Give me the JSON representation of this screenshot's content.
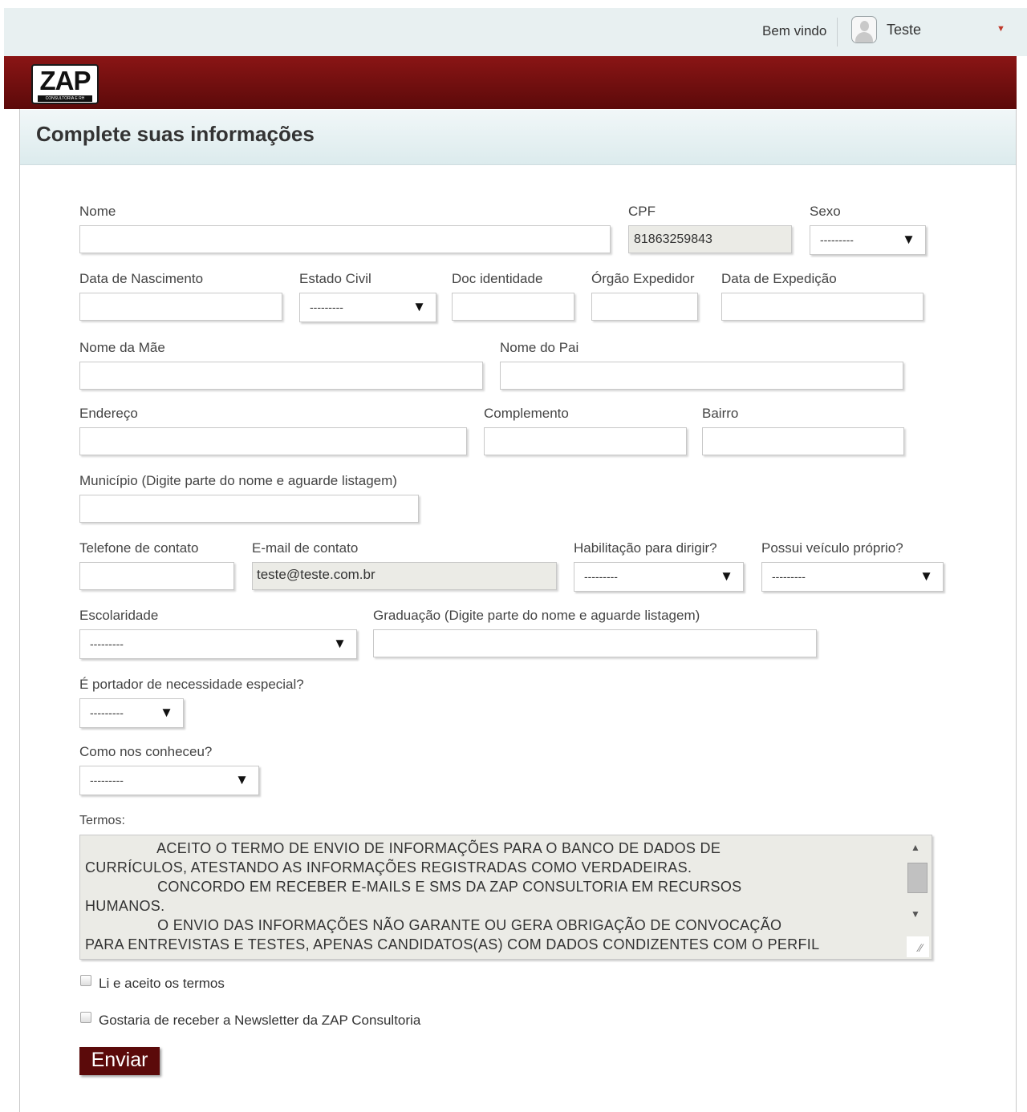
{
  "header": {
    "welcome": "Bem vindo",
    "username": "Teste",
    "user_menu_caret": "▼"
  },
  "brand": {
    "logo_text": "ZAP",
    "logo_sub": "CONSULTORIA E RH"
  },
  "page": {
    "title": "Complete suas informações"
  },
  "form": {
    "nome": {
      "label": "Nome",
      "value": ""
    },
    "cpf": {
      "label": "CPF",
      "value": "81863259843"
    },
    "sexo": {
      "label": "Sexo",
      "value": "---------"
    },
    "data_nascimento": {
      "label": "Data de Nascimento",
      "value": ""
    },
    "estado_civil": {
      "label": "Estado Civil",
      "value": "---------"
    },
    "doc_identidade": {
      "label": "Doc identidade",
      "value": ""
    },
    "orgao_expedidor": {
      "label": "Órgão Expedidor",
      "value": ""
    },
    "data_expedicao": {
      "label": "Data de Expedição",
      "value": ""
    },
    "nome_mae": {
      "label": "Nome da Mãe",
      "value": ""
    },
    "nome_pai": {
      "label": "Nome do Pai",
      "value": ""
    },
    "endereco": {
      "label": "Endereço",
      "value": ""
    },
    "complemento": {
      "label": "Complemento",
      "value": ""
    },
    "bairro": {
      "label": "Bairro",
      "value": ""
    },
    "municipio": {
      "label": "Município (Digite parte do nome e aguarde listagem)",
      "value": ""
    },
    "telefone": {
      "label": "Telefone de contato",
      "value": ""
    },
    "email": {
      "label": "E-mail de contato",
      "value": "teste@teste.com.br"
    },
    "habilitacao": {
      "label": "Habilitação para dirigir?",
      "value": "---------"
    },
    "veiculo": {
      "label": "Possui veículo próprio?",
      "value": "---------"
    },
    "escolaridade": {
      "label": "Escolaridade",
      "value": "---------"
    },
    "graduacao": {
      "label": "Graduação (Digite parte do nome e aguarde listagem)",
      "value": ""
    },
    "necessidade": {
      "label": "É portador de necessidade especial?",
      "value": "---------"
    },
    "como_conheceu": {
      "label": "Como nos conheceu?",
      "value": "---------"
    },
    "termos": {
      "label": "Termos:",
      "text": "                 ACEITO O TERMO DE ENVIO DE INFORMAÇÕES PARA O BANCO DE DADOS DE\nCURRÍCULOS, ATESTANDO AS INFORMAÇÕES REGISTRADAS COMO VERDADEIRAS.\n                 CONCORDO EM RECEBER E-MAILS E SMS DA ZAP CONSULTORIA EM RECURSOS\nHUMANOS.\n                 O ENVIO DAS INFORMAÇÕES NÃO GARANTE OU GERA OBRIGAÇÃO DE CONVOCAÇÃO\nPARA ENTREVISTAS E TESTES, APENAS CANDIDATOS(AS) COM DADOS CONDIZENTES COM O PERFIL"
    },
    "aceito_termos": {
      "label": "Li e aceito os termos",
      "checked": false
    },
    "newsletter": {
      "label": "Gostaria de receber a Newsletter da ZAP Consultoria",
      "checked": false
    },
    "submit_label": "Enviar"
  },
  "colors": {
    "brand_red": "#6b0f0f",
    "button_bg": "#5b0a0a",
    "header_bg": "#e8f0f1"
  },
  "icons": {
    "avatar": "user-avatar-icon",
    "select_arrow": "triangle-down-icon"
  }
}
